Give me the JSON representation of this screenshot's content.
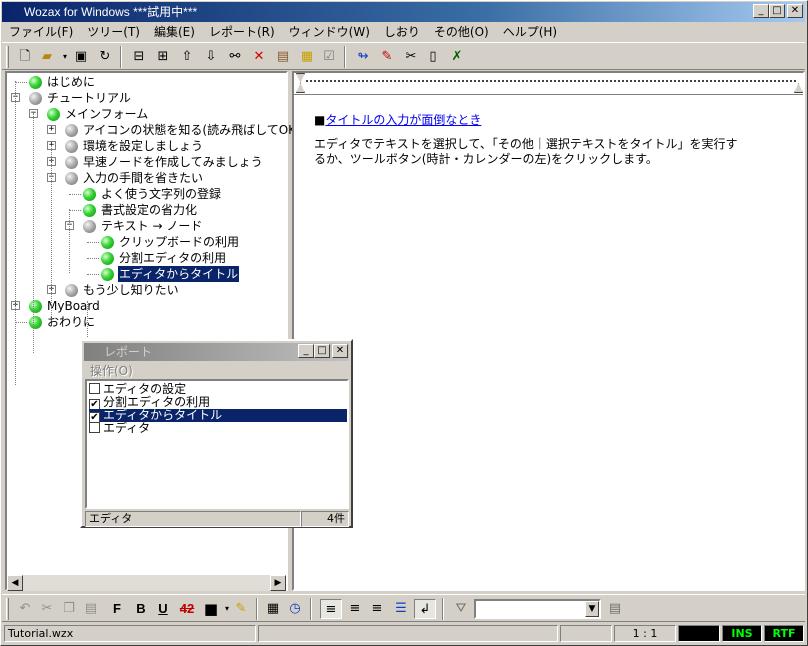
{
  "window": {
    "title": "Wozax for Windows ***試用中***"
  },
  "menu": [
    "ファイル(F)",
    "ツリー(T)",
    "編集(E)",
    "レポート(R)",
    "ウィンドウ(W)",
    "しおり",
    "その他(O)",
    "ヘルプ(H)"
  ],
  "title_buttons": {
    "minimize": "_",
    "maximize": "□",
    "close": "✕"
  },
  "tree": {
    "nodes": [
      {
        "label": "はじめに",
        "color": "green"
      },
      {
        "label": "チュートリアル",
        "color": "gray"
      },
      {
        "label": "メインフォーム",
        "color": "green"
      },
      {
        "label": "アイコンの状態を知る(読み飛ばしてOK)",
        "color": "gray"
      },
      {
        "label": "環境を設定しましょう",
        "color": "gray"
      },
      {
        "label": "早速ノードを作成してみましょう",
        "color": "gray"
      },
      {
        "label": "入力の手間を省きたい",
        "color": "gray"
      },
      {
        "label": "よく使う文字列の登録",
        "color": "green"
      },
      {
        "label": "書式設定の省力化",
        "color": "green"
      },
      {
        "label": "テキスト → ノード",
        "color": "gray"
      },
      {
        "label": "クリップボードの利用",
        "color": "green"
      },
      {
        "label": "分割エディタの利用",
        "color": "green"
      },
      {
        "label": "エディタからタイトル",
        "color": "green"
      },
      {
        "label": "もう少し知りたい",
        "color": "gray"
      },
      {
        "label": "MyBoard",
        "color": "green"
      },
      {
        "label": "おわりに",
        "color": "green"
      }
    ]
  },
  "editor": {
    "heading_mark": "■",
    "heading_link": "タイトルの入力が面倒なとき",
    "line1": "エディタでテキストを選択して、「その他｜選択テキストをタイトル」を実行す",
    "line2": "るか、ツールボタン(時計・カレンダーの左)をクリックします。"
  },
  "report": {
    "title": "レポート",
    "menu": "操作(O)",
    "items": [
      {
        "label": "エディタの設定",
        "checked": false
      },
      {
        "label": "分割エディタの利用",
        "checked": true
      },
      {
        "label": "エディタからタイトル",
        "checked": true
      },
      {
        "label": "エディタ",
        "checked": false
      }
    ],
    "status_left": "エディタ",
    "status_count": "4件"
  },
  "format_toolbar": {
    "bold": "F",
    "bold2": "B",
    "underline": "U",
    "strike": "42"
  },
  "statusbar": {
    "file": "Tutorial.wzx",
    "position": "1 : 1",
    "ins": "INS",
    "rtf": "RTF"
  },
  "colors": {
    "titlebar": "#0a246a",
    "selection": "#0a246a",
    "link": "#0000ee",
    "status_green": "#00ff00"
  }
}
